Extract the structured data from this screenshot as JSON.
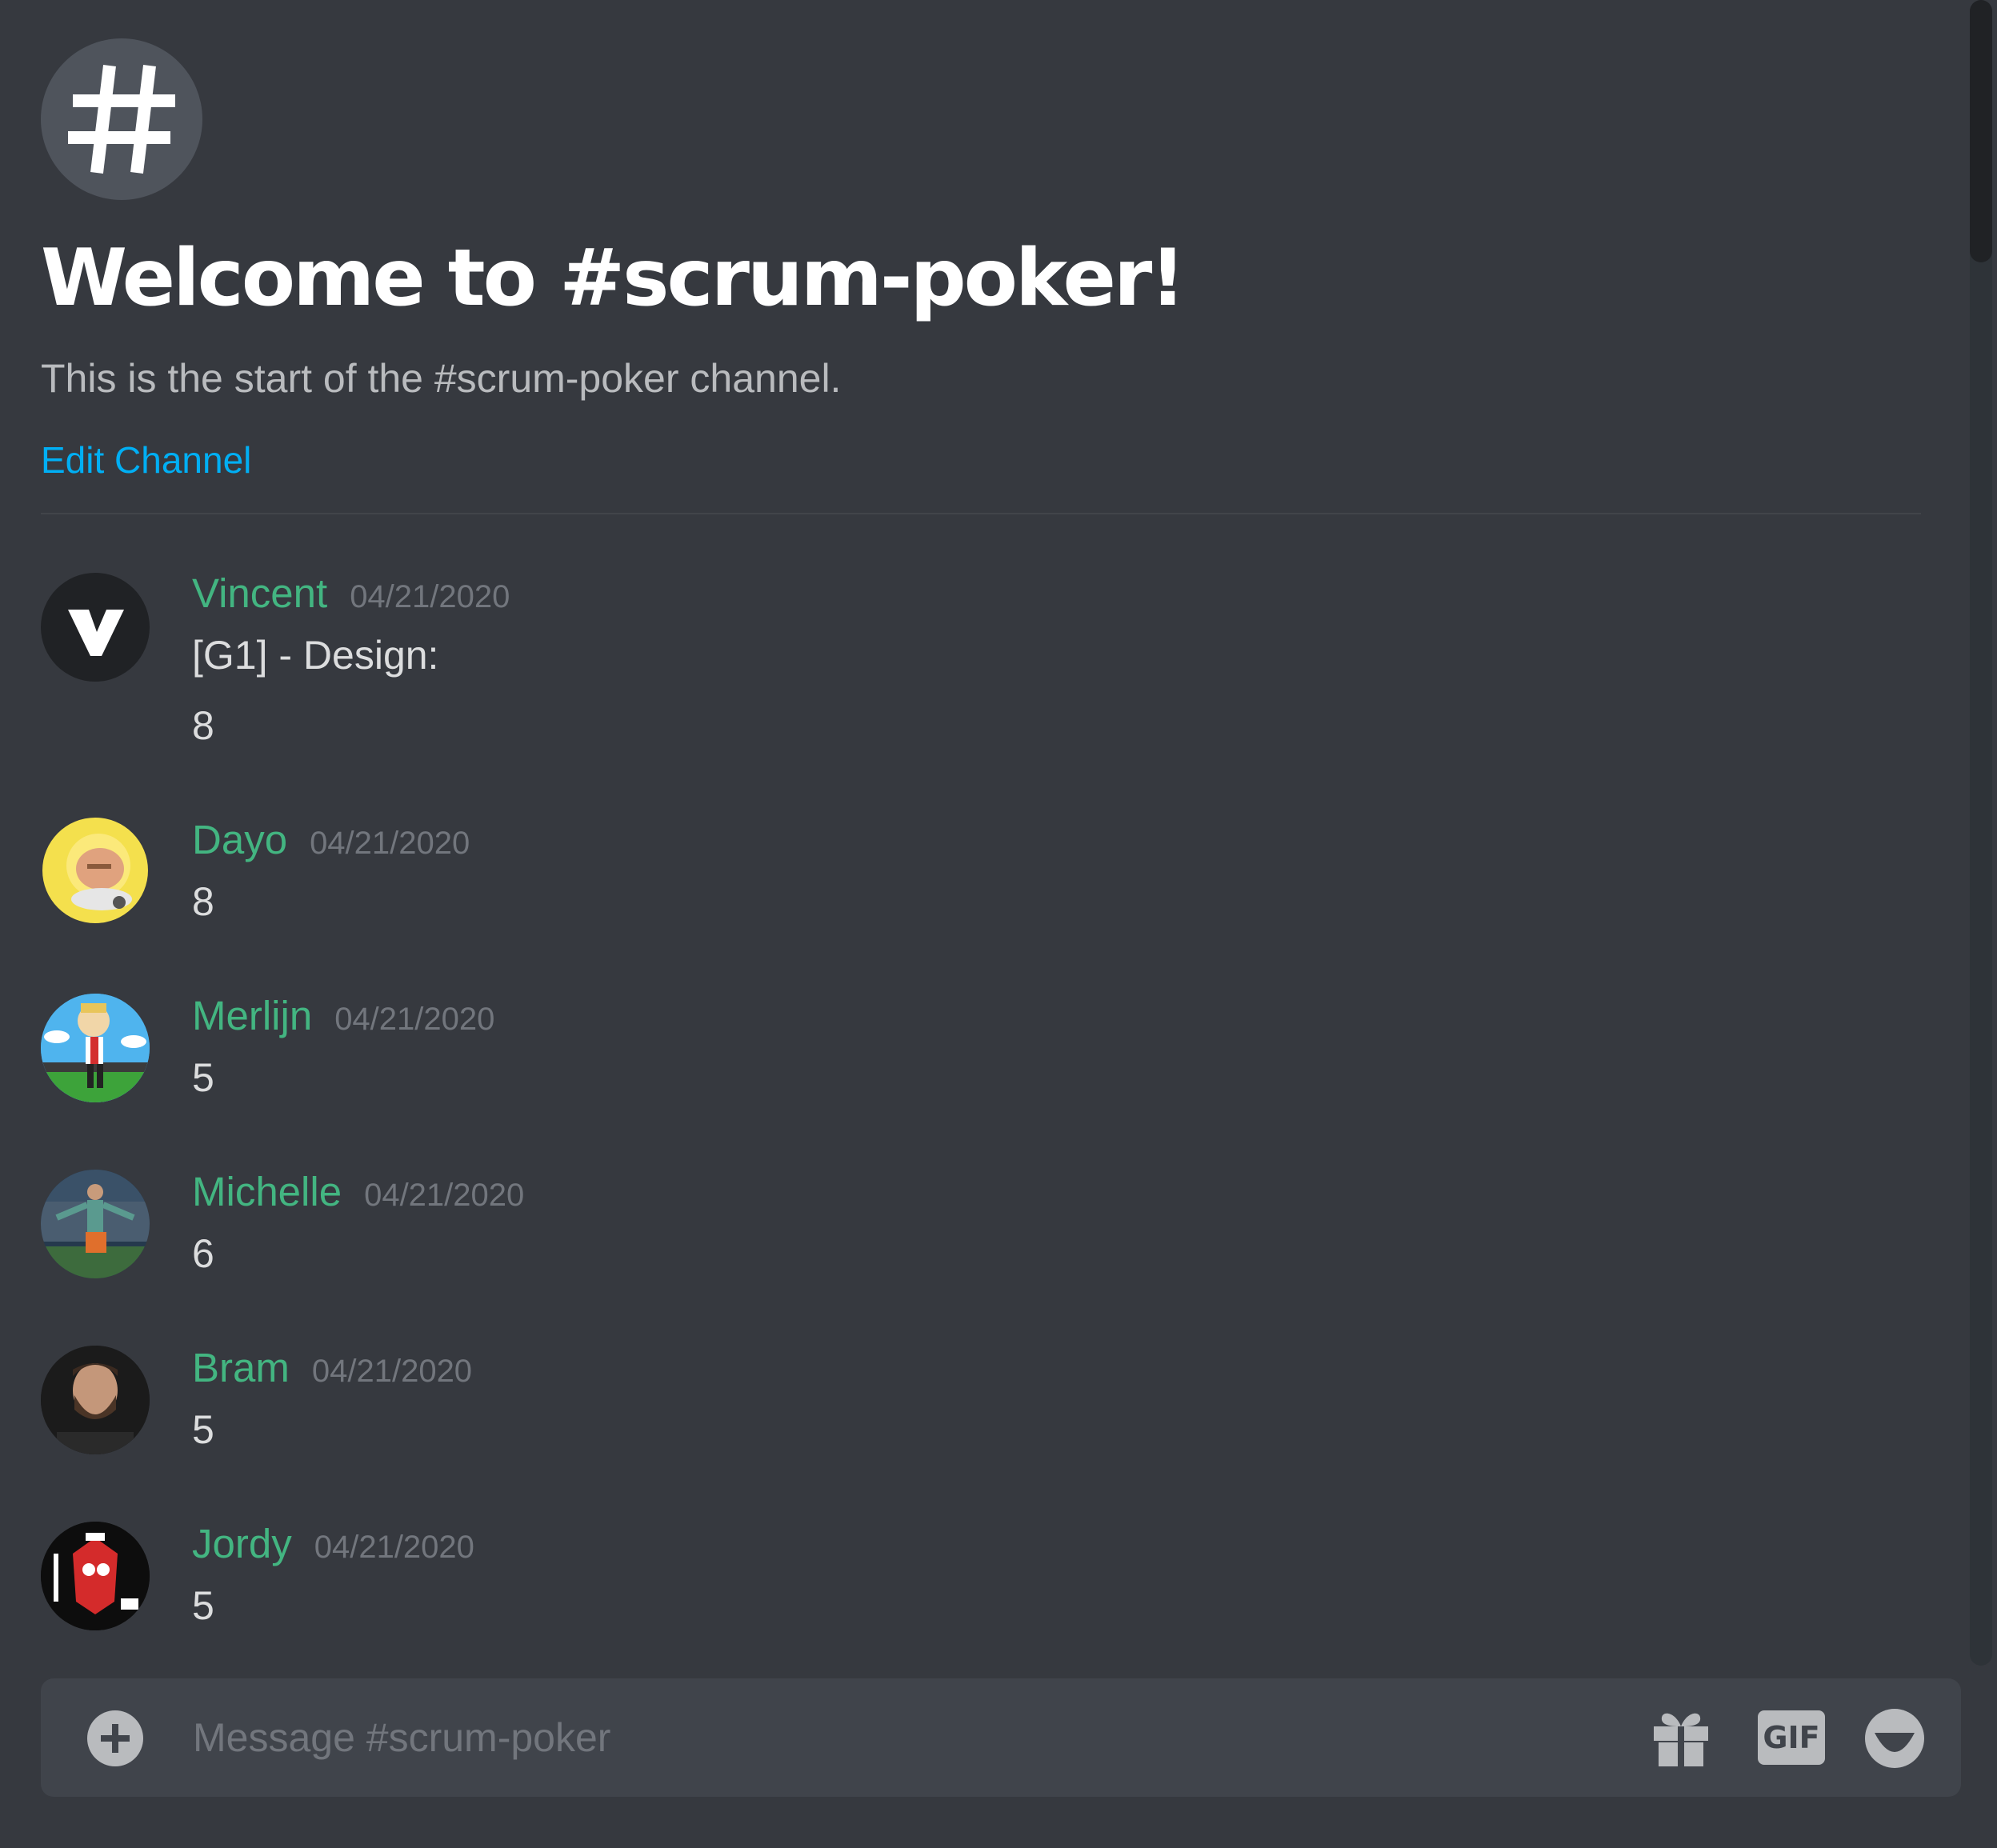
{
  "channel": {
    "icon": "hash-icon",
    "icon_glyph": "#",
    "welcome_title": "Welcome to #scrum-poker!",
    "welcome_subtitle": "This is the start of the #scrum-poker channel.",
    "edit_label": "Edit Channel"
  },
  "messages": [
    {
      "username": "Vincent",
      "timestamp": "04/21/2020",
      "lines": [
        "[G1] - Design:",
        "8"
      ],
      "avatar": "vincent-avatar"
    },
    {
      "username": "Dayo",
      "timestamp": "04/21/2020",
      "lines": [
        "8"
      ],
      "avatar": "dayo-avatar"
    },
    {
      "username": "Merlijn",
      "timestamp": "04/21/2020",
      "lines": [
        "5"
      ],
      "avatar": "merlijn-avatar"
    },
    {
      "username": "Michelle",
      "timestamp": "04/21/2020",
      "lines": [
        "6"
      ],
      "avatar": "michelle-avatar"
    },
    {
      "username": "Bram",
      "timestamp": "04/21/2020",
      "lines": [
        "5"
      ],
      "avatar": "bram-avatar"
    },
    {
      "username": "Jordy",
      "timestamp": "04/21/2020",
      "lines": [
        "5"
      ],
      "avatar": "jordy-avatar"
    }
  ],
  "composer": {
    "placeholder": "Message #scrum-poker",
    "value": "",
    "attach_icon": "plus-circle-icon",
    "gift_icon": "gift-icon",
    "gif_label": "GIF",
    "emoji_icon": "emoji-icon"
  },
  "colors": {
    "background": "#36393f",
    "username": "#43b581",
    "link": "#00aff4",
    "timestamp": "#72767d",
    "text": "#dcddde"
  }
}
